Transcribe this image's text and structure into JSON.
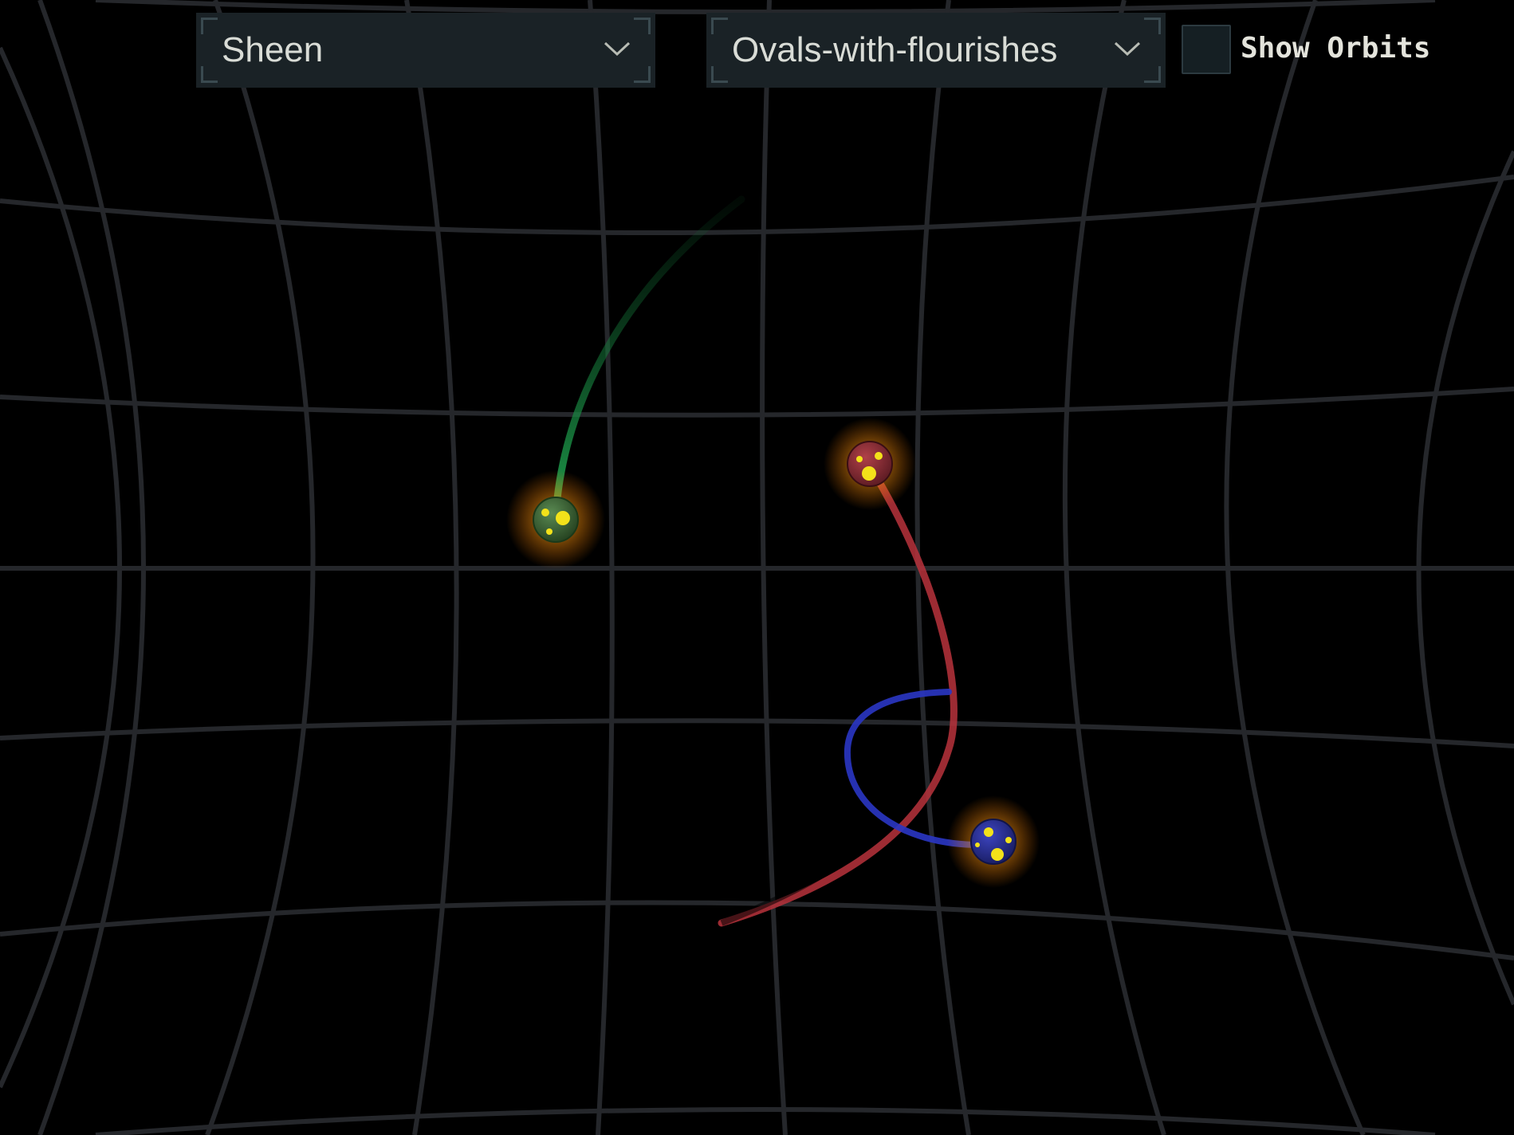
{
  "material_dropdown": {
    "value": "Sheen"
  },
  "scenario_dropdown": {
    "value": "Ovals-with-flourishes"
  },
  "show_orbits": {
    "label": "Show Orbits",
    "checked": false
  },
  "colors": {
    "background": "#000000",
    "grid": "#25272b",
    "ui_panel": "#1a2226",
    "ui_text": "#d9dcd6",
    "body_green": "#1f8c44",
    "body_red": "#b8323c",
    "body_blue": "#2a2fa8",
    "glow": "#ffb21a",
    "spots": "#f3e21a"
  },
  "bodies": [
    {
      "name": "green-body",
      "color": "#1f8c44",
      "trail": "#1a9a4a"
    },
    {
      "name": "red-body",
      "color": "#a8303c",
      "trail": "#c0394a"
    },
    {
      "name": "blue-body",
      "color": "#2b30a6",
      "trail": "#2a36c4"
    }
  ]
}
